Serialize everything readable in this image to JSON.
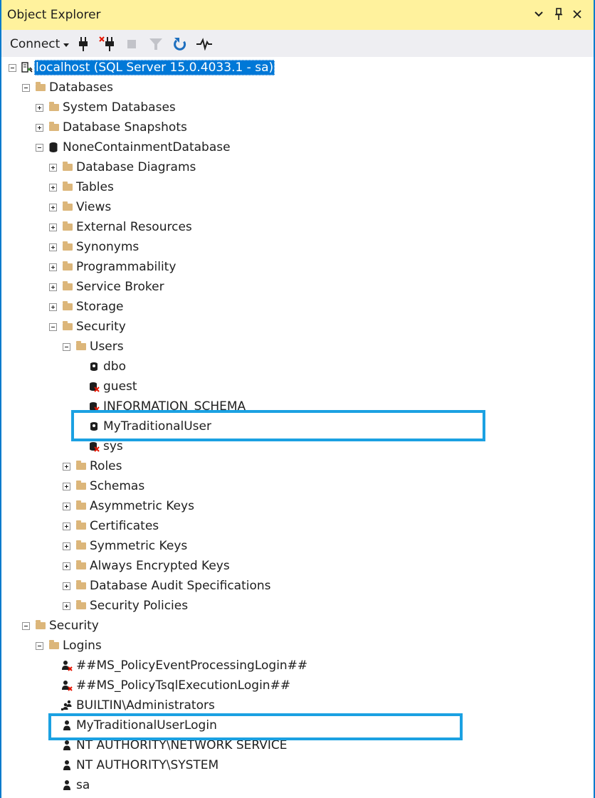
{
  "window": {
    "title": "Object Explorer",
    "accent": "#007acc",
    "title_bg": "#fff29d",
    "highlight": "#1ba1e2"
  },
  "toolbar": {
    "connect_label": "Connect",
    "tools": [
      "connect-object-explorer-icon",
      "disconnect-icon",
      "stop-icon",
      "filter-icon",
      "refresh-icon",
      "activity-monitor-icon"
    ]
  },
  "tree": {
    "server": "localhost (SQL Server 15.0.4033.1 - sa)",
    "databases": "Databases",
    "system_databases": "System Databases",
    "database_snapshots": "Database Snapshots",
    "db_name": "NoneContainmentDatabase",
    "db_items": [
      "Database Diagrams",
      "Tables",
      "Views",
      "External Resources",
      "Synonyms",
      "Programmability",
      "Service Broker",
      "Storage"
    ],
    "db_security": "Security",
    "users_folder": "Users",
    "users": [
      "dbo",
      "guest",
      "INFORMATION_SCHEMA",
      "MyTraditionalUser",
      "sys"
    ],
    "security_items": [
      "Roles",
      "Schemas",
      "Asymmetric Keys",
      "Certificates",
      "Symmetric Keys",
      "Always Encrypted Keys",
      "Database Audit Specifications",
      "Security Policies"
    ],
    "server_security": "Security",
    "logins_folder": "Logins",
    "logins": [
      "##MS_PolicyEventProcessingLogin##",
      "##MS_PolicyTsqlExecutionLogin##",
      "BUILTIN\\Administrators",
      "MyTraditionalUserLogin",
      "NT AUTHORITY\\NETWORK SERVICE",
      "NT AUTHORITY\\SYSTEM",
      "sa"
    ]
  }
}
